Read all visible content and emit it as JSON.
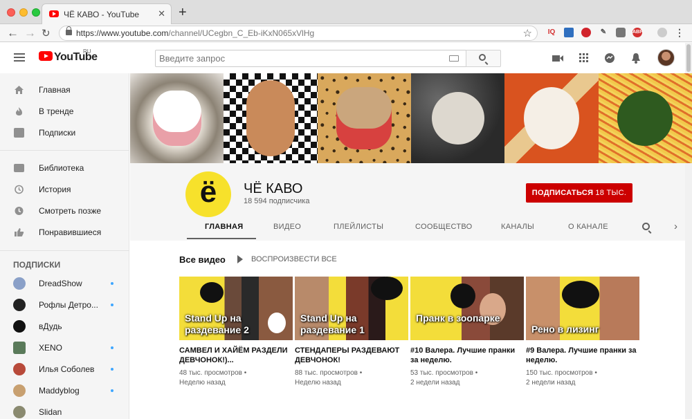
{
  "browser": {
    "tab_title": "ЧЁ КАВО - YouTube",
    "url_host": "https://www.youtube.com",
    "url_path": "/channel/UCegbn_C_Eb-iKxN065xVlHg",
    "extensions": [
      "IQ",
      "ABP"
    ]
  },
  "masthead": {
    "logo_text": "YouTube",
    "country": "RU",
    "search_placeholder": "Введите запрос"
  },
  "sidebar": {
    "main": [
      {
        "label": "Главная"
      },
      {
        "label": "В тренде"
      },
      {
        "label": "Подписки"
      }
    ],
    "library": [
      {
        "label": "Библиотека"
      },
      {
        "label": "История"
      },
      {
        "label": "Смотреть позже"
      },
      {
        "label": "Понравившиеся"
      }
    ],
    "subscriptions_heading": "ПОДПИСКИ",
    "subscriptions": [
      {
        "label": "DreadShow",
        "color": "#8aa0c8",
        "new": true
      },
      {
        "label": "Рофлы Детро...",
        "color": "#222222",
        "new": true
      },
      {
        "label": "вДудь",
        "color": "#111111",
        "new": false
      },
      {
        "label": "XENO",
        "color": "#5a7a5a",
        "new": true
      },
      {
        "label": "Илья Соболев",
        "color": "#b84a3a",
        "new": true
      },
      {
        "label": "Maddyblog",
        "color": "#c8a070",
        "new": true
      },
      {
        "label": "Slidan",
        "color": "#8a8a70",
        "new": false
      }
    ]
  },
  "channel": {
    "avatar_glyph": "ё",
    "name": "ЧЁ КАВО",
    "subscribers": "18 594 подписчика",
    "subscribe_label": "ПОДПИСАТЬСЯ",
    "subscribe_count": "18 ТЫС.",
    "tabs": [
      "ГЛАВНАЯ",
      "ВИДЕО",
      "ПЛЕЙЛИСТЫ",
      "СООБЩЕСТВО",
      "КАНАЛЫ",
      "О КАНАЛЕ"
    ]
  },
  "content": {
    "section_title": "Все видео",
    "play_all": "ВОСПРОИЗВЕСТИ ВСЕ",
    "videos": [
      {
        "caption": "Stand Up на раздевание 2",
        "title": "САМВЕЛ И ХАЙЁМ РАЗДЕЛИ ДЕВЧОНОК!)...",
        "views": "48 тыс. просмотров",
        "age": "Неделю назад"
      },
      {
        "caption": "Stand Up на раздевание 1",
        "title": "СТЕНДАПЕРЫ РАЗДЕВАЮТ ДЕВЧОНОК!",
        "views": "88 тыс. просмотров",
        "age": "Неделю назад"
      },
      {
        "caption": "Пранк в зоопарке",
        "title": "#10 Валера. Лучшие пранки за неделю.",
        "views": "53 тыс. просмотров",
        "age": "2 недели назад"
      },
      {
        "caption": "Рено в лизинг",
        "title": "#9 Валера. Лучшие пранки за неделю.",
        "views": "150 тыс. просмотров",
        "age": "2 недели назад"
      }
    ]
  }
}
